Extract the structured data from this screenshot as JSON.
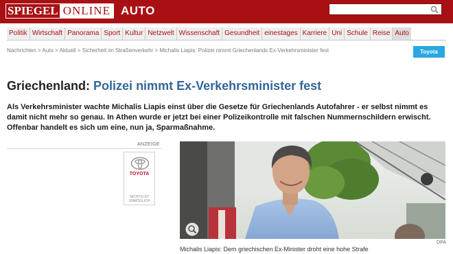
{
  "header": {
    "logo_part1": "SPIEGEL",
    "logo_part2": "ONLINE",
    "section": "AUTO",
    "search_placeholder": "",
    "brand_color": "#a81014"
  },
  "nav": {
    "items": [
      "Politik",
      "Wirtschaft",
      "Panorama",
      "Sport",
      "Kultur",
      "Netzwelt",
      "Wissenschaft",
      "Gesundheit",
      "einestages",
      "Karriere",
      "Uni",
      "Schule",
      "Reise",
      "Auto"
    ],
    "active_index": 13
  },
  "breadcrumb": "Nachrichten > Auto > Aktuell > Sicherheit im Straßenverkehr > Michalis Liapis: Polizei nimmt Griechenlands Ex-Verkehrsminister fest",
  "sponsor_button": "Toyota",
  "article": {
    "kicker": "Griechenland:",
    "title": "Polizei nimmt Ex-Verkehrsminister fest",
    "intro": "Als Verkehrsminister wachte Michalis Liapis einst über die Gesetze für Griechenlands Autofahrer - er selbst nimmt es damit nicht mehr so genau. In Athen wurde er jetzt bei einer Polizeikontrolle mit falschen Nummernschildern erwischt. Offenbar handelt es sich um eine, nun ja, Sparmaßnahme.",
    "photo_credit": "DPA",
    "caption": "Michalis Liapis: Dem griechischen Ex-Minister droht eine hohe Strafe"
  },
  "ad": {
    "label": "ANZEIGE",
    "brand": "TOYOTA",
    "slogan_line1": "NICHTS IST",
    "slogan_line2": "UNMÖGLICH"
  },
  "icons": [
    "search-icon",
    "zoom-icon",
    "toyota-emblem"
  ]
}
